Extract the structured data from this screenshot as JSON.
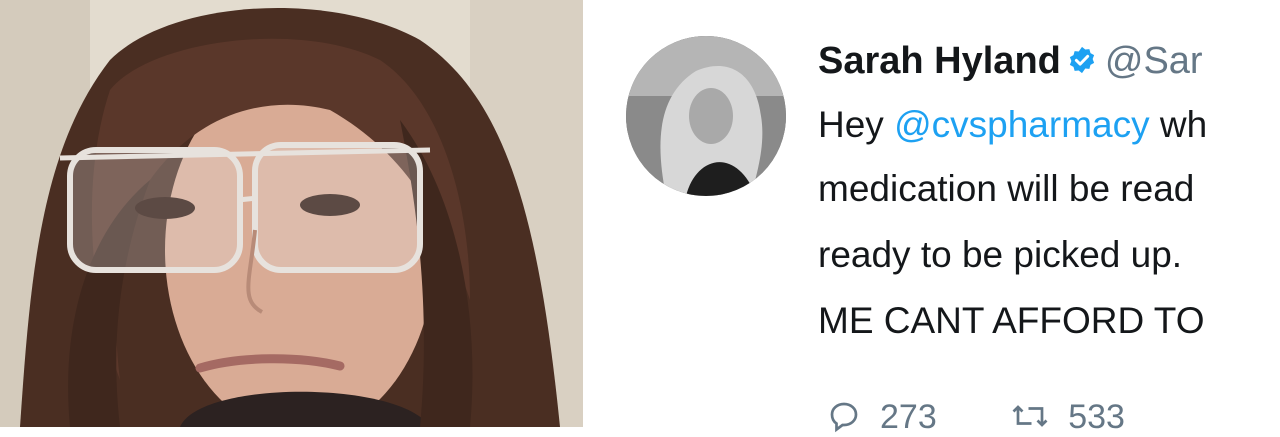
{
  "tweet": {
    "author_name": "Sarah Hyland",
    "author_handle": "@Sar",
    "line1_prefix": "Hey ",
    "line1_mention": "@cvspharmacy",
    "line1_suffix": " wh",
    "line2": "medication will be read",
    "line3": "ready to be picked up.",
    "line4": "ME CANT AFFORD TO",
    "reply_count": "273",
    "retweet_count": "533"
  },
  "colors": {
    "mention": "#1da1f2",
    "verified_badge": "#1da1f2",
    "handle": "#657786"
  },
  "icons": [
    "verified-badge-icon",
    "reply-icon",
    "retweet-icon"
  ]
}
